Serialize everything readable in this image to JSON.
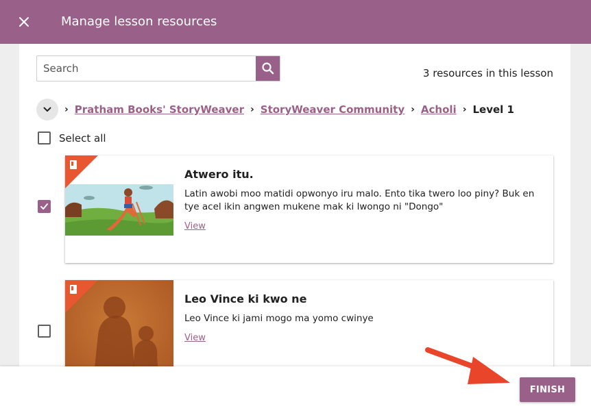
{
  "app_bar": {
    "title": "Manage lesson resources",
    "close_icon": "close-icon"
  },
  "search": {
    "placeholder": "Search",
    "value": "",
    "icon": "search-icon"
  },
  "resource_count": "3 resources in this lesson",
  "breadcrumb": {
    "toggle_icon": "chevron-down-icon",
    "items": [
      {
        "label": "Pratham Books' StoryWeaver",
        "link": true
      },
      {
        "label": "StoryWeaver Community",
        "link": true
      },
      {
        "label": "Acholi",
        "link": true
      },
      {
        "label": "Level 1",
        "link": false
      }
    ]
  },
  "select_all": {
    "label": "Select all",
    "checked": false
  },
  "resources": [
    {
      "title": "Atwero itu.",
      "description": "Latin awobi moo matidi opwonyo iru malo. Ento tika twero loo piny? Buk en tye acel ikin angwen mukene mak ki lwongo ni \"Dongo\"",
      "view_label": "View",
      "checked": true,
      "type_icon": "book-icon"
    },
    {
      "title": "Leo Vince ki kwo ne",
      "description": "Leo Vince ki jami mogo ma yomo cwinye",
      "view_label": "View",
      "checked": false,
      "type_icon": "book-icon"
    }
  ],
  "footer": {
    "finish_label": "FINISH"
  },
  "colors": {
    "primary": "#996189",
    "corner_badge": "#e8572f",
    "annotation_arrow": "#e8452a"
  }
}
